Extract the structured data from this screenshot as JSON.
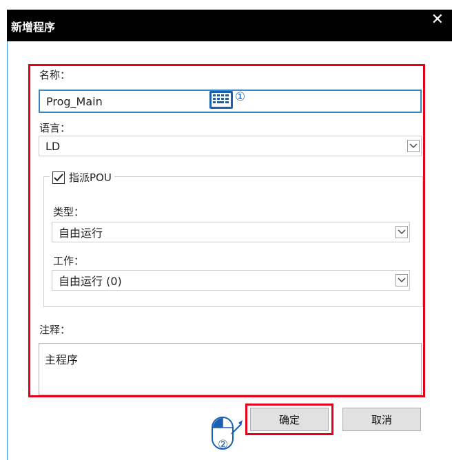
{
  "dialog": {
    "title": "新增程序",
    "close_glyph": "✕"
  },
  "form": {
    "name_label": "名称：",
    "name_value": "Prog_Main",
    "language_label": "语言：",
    "language_value": "LD",
    "assign_pou_label": "指派POU",
    "assign_pou_checked": true,
    "type_label": "类型：",
    "type_value": "自由运行",
    "task_label": "工作：",
    "task_value": "自由运行 (0)",
    "comment_label": "注释：",
    "comment_value": "主程序"
  },
  "buttons": {
    "ok_label": "确定",
    "cancel_label": "取消"
  },
  "annotations": {
    "step1": "①",
    "step2": "②"
  },
  "colors": {
    "highlight": "#e4001b",
    "focus_border": "#3b87c6",
    "titlebar": "#000000",
    "annotation_blue": "#1b5fb0"
  },
  "icons": {
    "keyboard": "keyboard-icon",
    "mouse": "mouse-icon",
    "dropdown": "chevron-down-icon",
    "checkbox": "checkmark-icon"
  }
}
